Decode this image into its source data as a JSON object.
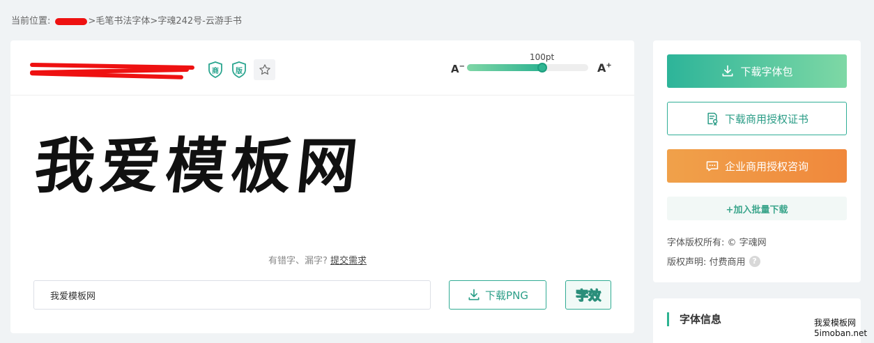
{
  "breadcrumb": {
    "prefix": "当前位置:",
    "path": ">毛笔书法字体>字魂242号-云游手书"
  },
  "toolbar": {
    "badge_commercial": "商",
    "badge_copyright": "版",
    "size_minus": "A",
    "size_plus": "A",
    "size_value": "100pt",
    "size_level": 0.62
  },
  "preview": {
    "text": "我爱模板网",
    "error_hint": "有错字、漏字?",
    "submit_link": "提交需求"
  },
  "input": {
    "value": "我爱模板网"
  },
  "actions": {
    "download_png": "下载PNG",
    "effect_label": "字效"
  },
  "sidebar": {
    "download_font": "下载字体包",
    "download_cert": "下载商用授权证书",
    "consult": "企业商用授权咨询",
    "batch_add": "+加入批量下载",
    "copyright_owner": "字体版权所有: © 字魂网",
    "copyright_statement": "版权声明: 付费商用",
    "help": "?"
  },
  "info_card": {
    "title": "字体信息"
  },
  "watermark": {
    "line1": "我爱模板网",
    "line2": "5imoban.net"
  },
  "colors": {
    "primary": "#2eb391",
    "orange": "#f0883c",
    "redact": "#ee1111"
  }
}
